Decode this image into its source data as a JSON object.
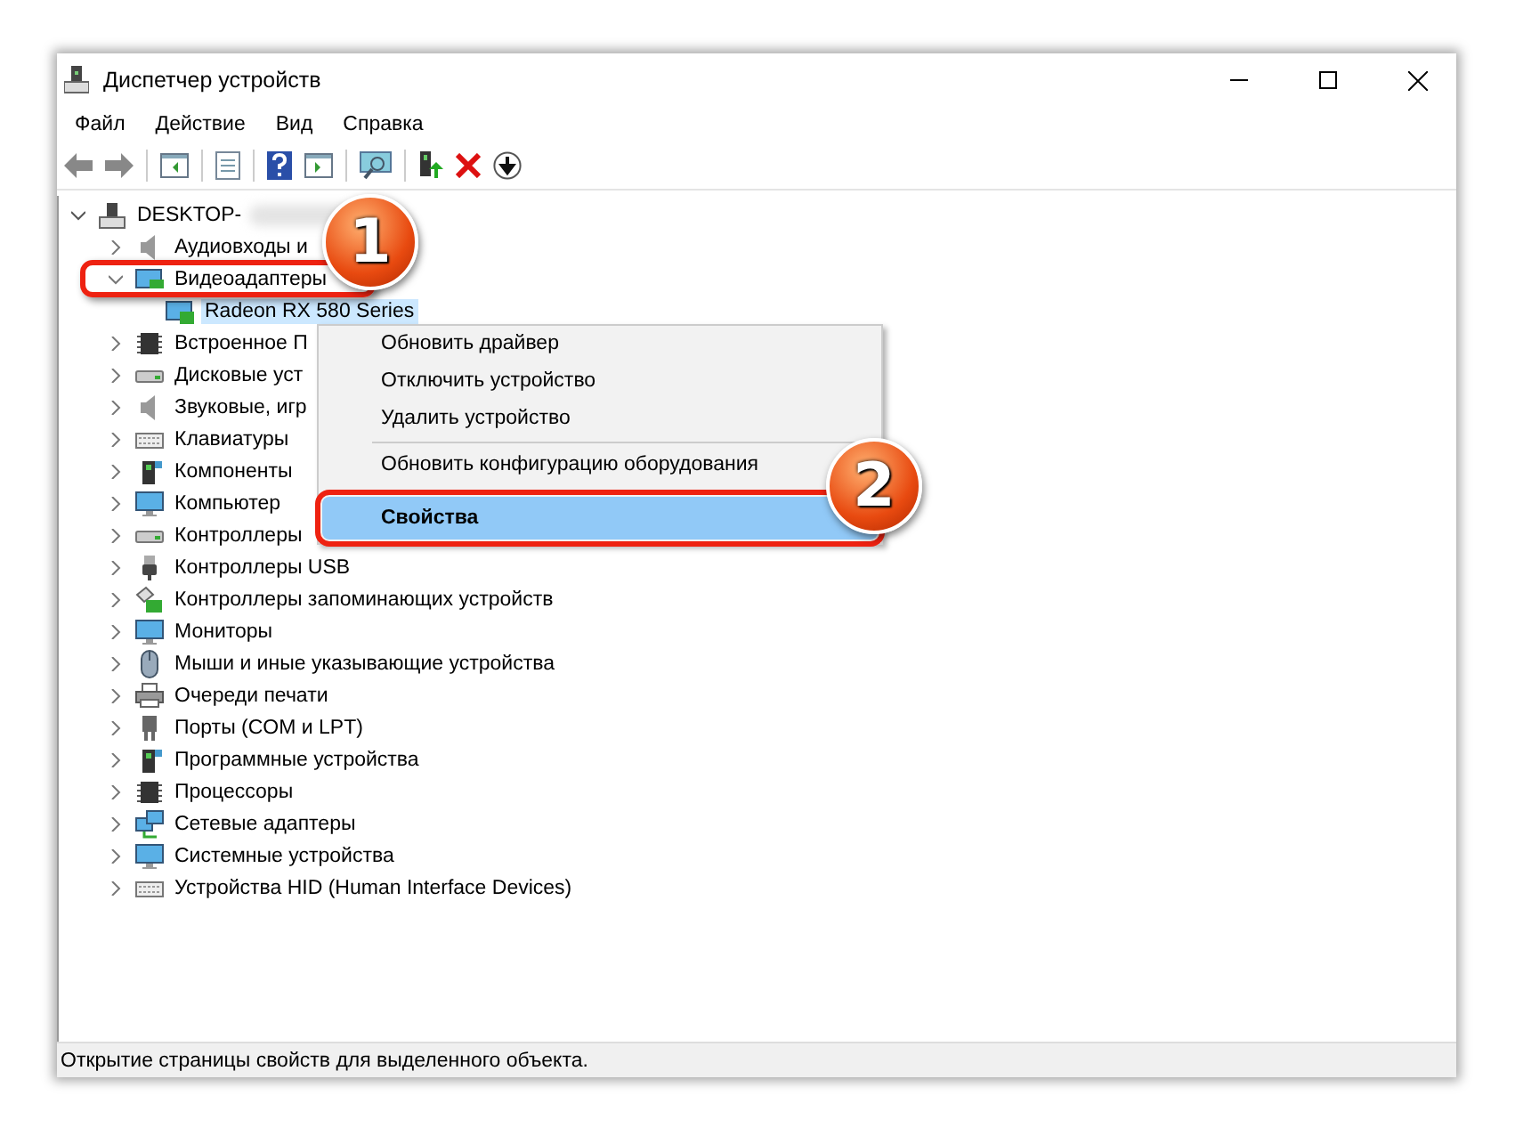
{
  "window": {
    "title": "Диспетчер устройств"
  },
  "menu": [
    "Файл",
    "Действие",
    "Вид",
    "Справка"
  ],
  "tree": {
    "label": "DESKTOP-",
    "kind": "computer",
    "expanded": true,
    "children": [
      {
        "label": "Аудиовходы и",
        "kind": "audio",
        "expanded": false,
        "selected": false
      },
      {
        "label": "Видеоадаптеры",
        "kind": "display",
        "expanded": true,
        "selected": false,
        "children": [
          {
            "label": "Radeon RX 580 Series",
            "kind": "display",
            "selected": true
          }
        ]
      },
      {
        "label": "Встроенное П",
        "kind": "chip",
        "expanded": false,
        "selected": false
      },
      {
        "label": "Дисковые уст",
        "kind": "disk",
        "expanded": false,
        "selected": false
      },
      {
        "label": "Звуковые, игр",
        "kind": "audio",
        "expanded": false,
        "selected": false
      },
      {
        "label": "Клавиатуры",
        "kind": "keyboard",
        "expanded": false,
        "selected": false
      },
      {
        "label": "Компоненты",
        "kind": "software",
        "expanded": false,
        "selected": false
      },
      {
        "label": "Компьютер",
        "kind": "monitor",
        "expanded": false,
        "selected": false
      },
      {
        "label": "Контроллеры",
        "kind": "disk",
        "expanded": false,
        "selected": false
      },
      {
        "label": "Контроллеры USB",
        "kind": "usb",
        "expanded": false,
        "selected": false
      },
      {
        "label": "Контроллеры запоминающих устройств",
        "kind": "storage",
        "expanded": false,
        "selected": false
      },
      {
        "label": "Мониторы",
        "kind": "monitor",
        "expanded": false,
        "selected": false
      },
      {
        "label": "Мыши и иные указывающие устройства",
        "kind": "mouse",
        "expanded": false,
        "selected": false
      },
      {
        "label": "Очереди печати",
        "kind": "printer",
        "expanded": false,
        "selected": false
      },
      {
        "label": "Порты (COM и LPT)",
        "kind": "port",
        "expanded": false,
        "selected": false
      },
      {
        "label": "Программные устройства",
        "kind": "software",
        "expanded": false,
        "selected": false
      },
      {
        "label": "Процессоры",
        "kind": "chip",
        "expanded": false,
        "selected": false
      },
      {
        "label": "Сетевые адаптеры",
        "kind": "network",
        "expanded": false,
        "selected": false
      },
      {
        "label": "Системные устройства",
        "kind": "monitor",
        "expanded": false,
        "selected": false
      },
      {
        "label": "Устройства HID (Human Interface Devices)",
        "kind": "keyboard",
        "expanded": false,
        "selected": false
      }
    ]
  },
  "context_menu": [
    {
      "kind": "item",
      "label": "Обновить драйвер",
      "selected": false
    },
    {
      "kind": "item",
      "label": "Отключить устройство",
      "selected": false
    },
    {
      "kind": "item",
      "label": "Удалить устройство",
      "selected": false
    },
    {
      "kind": "separator"
    },
    {
      "kind": "item",
      "label": "Обновить конфигурацию оборудования",
      "selected": false
    },
    {
      "kind": "item",
      "label": "Свойства",
      "selected": true
    }
  ],
  "callouts": [
    {
      "label": "1"
    },
    {
      "label": "2"
    }
  ],
  "status_bar": "Открытие страницы свойств для выделенного объекта."
}
